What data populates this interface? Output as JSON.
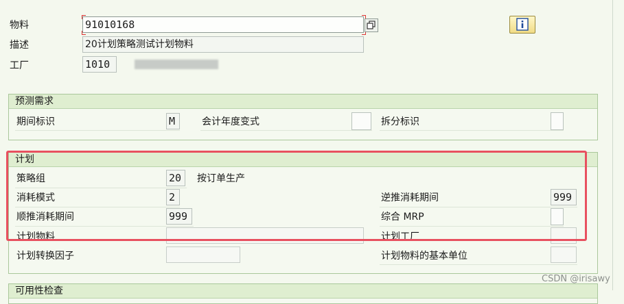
{
  "header": {
    "material_label": "物料",
    "material_value": "91010168",
    "description_label": "描述",
    "description_value": "20计划策略测试计划物料",
    "plant_label": "工厂",
    "plant_value": "1010"
  },
  "forecast_group": {
    "title": "预测需求",
    "period_indicator_label": "期间标识",
    "period_indicator_value": "M",
    "fiscal_year_variant_label": "会计年度变式",
    "fiscal_year_variant_value": "",
    "split_indicator_label": "拆分标识",
    "split_indicator_value": ""
  },
  "planning_group": {
    "title": "计划",
    "strategy_group_label": "策略组",
    "strategy_group_value": "20",
    "strategy_group_desc": "按订单生产",
    "consumption_mode_label": "消耗模式",
    "consumption_mode_value": "2",
    "backward_period_label": "逆推消耗期间",
    "backward_period_value": "999",
    "forward_period_label": "顺推消耗期间",
    "forward_period_value": "999",
    "mixed_mrp_label": "综合 MRP",
    "mixed_mrp_value": "",
    "planning_material_label": "计划物料",
    "planning_material_value": "",
    "planning_plant_label": "计划工厂",
    "planning_plant_value": "",
    "conv_factor_label": "计划转换因子",
    "conv_factor_value": "",
    "base_unit_label": "计划物料的基本单位",
    "base_unit_value": ""
  },
  "next_group": {
    "title": "可用性检查"
  },
  "watermark": "CSDN @irisawy",
  "colors": {
    "highlight_border": "#e8505f",
    "group_header": "#dfeed0",
    "background": "#f4f8ee"
  }
}
